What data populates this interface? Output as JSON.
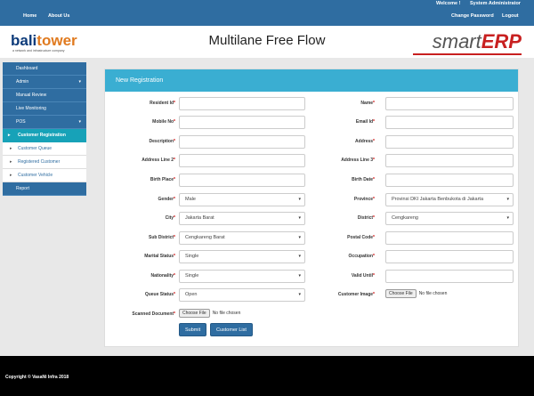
{
  "topbar": {
    "home": "Home",
    "about": "About Us",
    "welcome": "Welcome !",
    "user": "System Administrator",
    "change_password": "Change Password",
    "logout": "Logout"
  },
  "header": {
    "logo_bali": "bali",
    "logo_tower": "tower",
    "logo_tagline": "a network and infrastructure company",
    "app_title": "Multilane Free Flow",
    "brand_smart": "smart",
    "brand_erp": "ERP"
  },
  "sidebar": {
    "items": [
      {
        "label": "Dashboard"
      },
      {
        "label": "Admin",
        "caret": "▾"
      },
      {
        "label": "Manual Review"
      },
      {
        "label": "Live Monitoring"
      },
      {
        "label": "POS",
        "caret": "▾"
      },
      {
        "label": "Customer Registration",
        "bullet": "▸"
      },
      {
        "label": "Customer Queue",
        "bullet": "▸"
      },
      {
        "label": "Registered Customer",
        "bullet": "▸"
      },
      {
        "label": "Customer Vehicle",
        "bullet": "▸"
      },
      {
        "label": "Report"
      }
    ]
  },
  "form": {
    "title": "New Registration",
    "required_mark": "*",
    "left": [
      {
        "label": "Resident Id",
        "value": ""
      },
      {
        "label": "Mobile No",
        "value": ""
      },
      {
        "label": "Description",
        "value": ""
      },
      {
        "label": "Address Line 2",
        "value": ""
      },
      {
        "label": "Birth Place",
        "value": ""
      },
      {
        "label": "Gender",
        "value": "Male"
      },
      {
        "label": "City",
        "value": "Jakarta Barat"
      },
      {
        "label": "Sub District",
        "value": "Cengkareng Barat"
      },
      {
        "label": "Marital Status",
        "value": "Single"
      },
      {
        "label": "Nationality",
        "value": "Single"
      },
      {
        "label": "Queue Status",
        "value": "Open"
      }
    ],
    "right": [
      {
        "label": "Name",
        "value": ""
      },
      {
        "label": "Email Id",
        "value": ""
      },
      {
        "label": "Address",
        "value": ""
      },
      {
        "label": "Address Line 3",
        "value": ""
      },
      {
        "label": "Birth Date",
        "value": ""
      },
      {
        "label": "Province",
        "value": "Provinsi DKI Jakarta Benbukota di Jakarta"
      },
      {
        "label": "District",
        "value": "Cengkareng"
      },
      {
        "label": "Postal Code",
        "value": ""
      },
      {
        "label": "Occupation",
        "value": ""
      },
      {
        "label": "Valid Until",
        "value": ""
      },
      {
        "label": "Customer Image",
        "value": ""
      }
    ],
    "scanned_label": "Scanned Document",
    "choose_file": "Choose File",
    "no_file": "No file chosen",
    "select_arrow": "▾",
    "submit": "Submit",
    "customer_list": "Customer List"
  },
  "footer": {
    "copyright": "Copyright © VasaNi Infra 2018"
  }
}
